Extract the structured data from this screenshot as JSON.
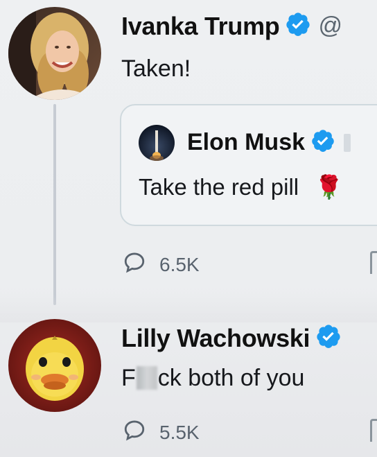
{
  "tweets": [
    {
      "author": "Ivanka Trump",
      "handle": "@",
      "text": "Taken!",
      "quote": {
        "author": "Elon Musk",
        "text": "Take the red pill",
        "emoji": "🌹"
      },
      "reply_count": "6.5K"
    },
    {
      "author": "Lilly Wachowski",
      "text_start": "F",
      "text_end": "ck both of you",
      "reply_count": "5.5K"
    }
  ],
  "colors": {
    "verified": "#1d9bf0",
    "text": "#0f1419",
    "muted": "#5b6670",
    "card_border": "#cfd9de",
    "thread_line": "#c7ccd3"
  },
  "icons": [
    "verified-icon",
    "reply-icon",
    "red-rose-emoji"
  ]
}
